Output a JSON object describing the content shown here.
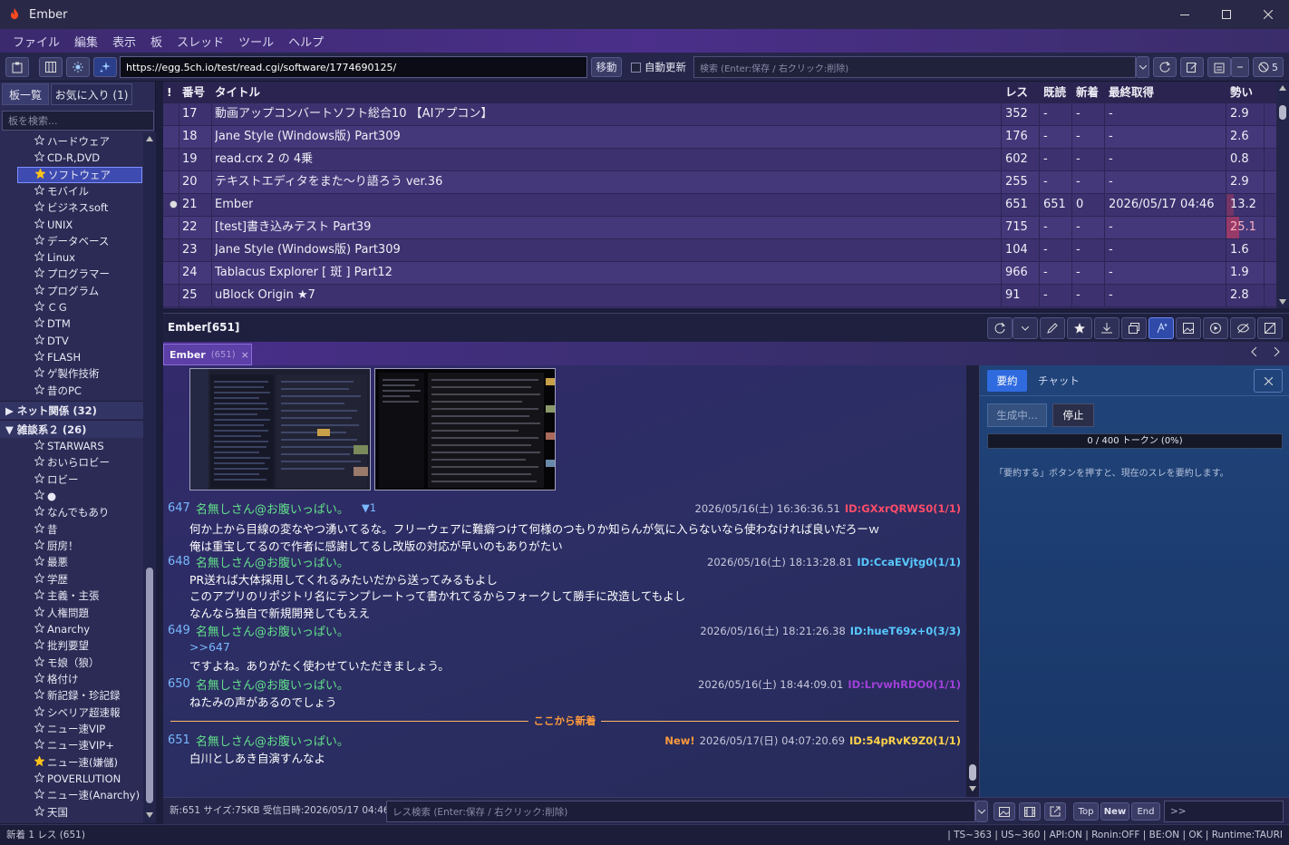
{
  "window": {
    "title": "Ember"
  },
  "menu": [
    "ファイル",
    "編集",
    "表示",
    "板",
    "スレッド",
    "ツール",
    "ヘルプ"
  ],
  "toolbar": {
    "url": "https://egg.5ch.io/test/read.cgi/software/1774690125/",
    "go_label": "移動",
    "auto_update_label": "自動更新",
    "search_placeholder": "検索 (Enter:保存 / 右クリック:削除)",
    "ng_count": "5"
  },
  "left_panel": {
    "tab_boards": "板一覧",
    "tab_favorites": "お気に入り (1)",
    "search_placeholder": "板を検索...",
    "boards_top": [
      "ハードウェア",
      "CD-R,DVD",
      "ソフトウェア",
      "モバイル",
      "ビジネスsoft",
      "UNIX",
      "データベース",
      "Linux",
      "プログラマー",
      "プログラム",
      "ＣＧ",
      "DTM",
      "DTV",
      "FLASH",
      "ゲ製作技術",
      "昔のPC"
    ],
    "category_net": "▶ ネット関係 (32)",
    "category_zatsudan": "▼ 雑談系２ (26)",
    "boards_bottom": [
      "STARWARS",
      "おいらロビー",
      "ロビー",
      "●",
      "なんでもあり",
      "昔",
      "厨房！",
      "最悪",
      "学歴",
      "主義・主張",
      "人権問題",
      "Anarchy",
      "批判要望",
      "モ娘（狼）",
      "格付け",
      "新記録・珍記録",
      "シベリア超速報",
      "ニュー速VIP",
      "ニュー速VIP+",
      "ニュー速(嫌儲)",
      "POVERLUTION",
      "ニュー速(Anarchy)",
      "天国"
    ]
  },
  "thread_list": {
    "headers": {
      "mark": "!",
      "num": "番号",
      "title": "タイトル",
      "res": "レス",
      "read": "既読",
      "new": "新着",
      "last": "最終取得",
      "momentum": "勢い"
    },
    "rows": [
      {
        "mark": "",
        "num": "17",
        "title": "動画アップコンバートソフト総合10 【AIアプコン】",
        "res": "352",
        "read": "-",
        "new": "-",
        "last": "-",
        "momentum": "2.9"
      },
      {
        "mark": "",
        "num": "18",
        "title": "Jane Style (Windows版) Part309",
        "res": "176",
        "read": "-",
        "new": "-",
        "last": "-",
        "momentum": "2.6"
      },
      {
        "mark": "",
        "num": "19",
        "title": "read.crx 2 の 4乗",
        "res": "602",
        "read": "-",
        "new": "-",
        "last": "-",
        "momentum": "0.8"
      },
      {
        "mark": "",
        "num": "20",
        "title": "テキストエディタをまた～り語ろう ver.36",
        "res": "255",
        "read": "-",
        "new": "-",
        "last": "-",
        "momentum": "2.9"
      },
      {
        "mark": "●",
        "num": "21",
        "title": "Ember",
        "res": "651",
        "read": "651",
        "new": "0",
        "last": "2026/05/17 04:46",
        "momentum": "13.2"
      },
      {
        "mark": "",
        "num": "22",
        "title": "[test]書き込みテスト Part39",
        "res": "715",
        "read": "-",
        "new": "-",
        "last": "-",
        "momentum": "25.1"
      },
      {
        "mark": "",
        "num": "23",
        "title": "Jane Style (Windows版) Part309",
        "res": "104",
        "read": "-",
        "new": "-",
        "last": "-",
        "momentum": "1.6"
      },
      {
        "mark": "",
        "num": "24",
        "title": "Tablacus Explorer [ 斑 ] Part12",
        "res": "966",
        "read": "-",
        "new": "-",
        "last": "-",
        "momentum": "1.9"
      },
      {
        "mark": "",
        "num": "25",
        "title": "uBlock Origin ★7",
        "res": "91",
        "read": "-",
        "new": "-",
        "last": "-",
        "momentum": "2.8"
      }
    ]
  },
  "thread_view": {
    "title": "Ember[651]",
    "tab_name": "Ember",
    "tab_count": "(651)",
    "new_divider": "ここから新着",
    "posts": [
      {
        "num": "647",
        "name": "名無しさん@お腹いっぱい。",
        "ref": "▼1",
        "date": "2026/05/16(土) 16:36:36.51",
        "id": "ID:GXxrQRWS0(1/1)",
        "id_color": "#ff4d6a",
        "lines": [
          "何か上から目線の変なやつ湧いてるな。フリーウェアに難癖つけて何様のつもりか知らんが気に入らないなら使わなければ良いだろーｗ",
          "俺は重宝してるので作者に感謝してるし改版の対応が早いのもありがたい"
        ]
      },
      {
        "num": "648",
        "name": "名無しさん@お腹いっぱい。",
        "date": "2026/05/16(土) 18:13:28.81",
        "id": "ID:CcaEVjtg0(1/1)",
        "id_color": "#58c8ff",
        "lines": [
          "PR送れば大体採用してくれるみたいだから送ってみるもよし",
          "このアプリのリポジトリ名にテンプレートって書かれてるからフォークして勝手に改造してもよし",
          "なんなら独自で新規開発してもええ"
        ]
      },
      {
        "num": "649",
        "name": "名無しさん@お腹いっぱい。",
        "date": "2026/05/16(土) 18:21:26.38",
        "id": "ID:hueT69x+0(3/3)",
        "id_color": "#58c8ff",
        "anchor": ">>647",
        "lines": [
          "ですよね。ありがたく使わせていただきましょう。"
        ]
      },
      {
        "num": "650",
        "name": "名無しさん@お腹いっぱい。",
        "date": "2026/05/16(土) 18:44:09.01",
        "id": "ID:LrvwhRDO0(1/1)",
        "id_color": "#a040d8",
        "lines": [
          "ねたみの声があるのでしょう"
        ]
      },
      {
        "num": "651",
        "name": "名無しさん@お腹いっぱい。",
        "new_badge": "New!",
        "date": "2026/05/17(日) 04:07:20.69",
        "id": "ID:54pRvK9Z0(1/1)",
        "id_color": "#ffd24a",
        "lines": [
          "白川としあき自演すんなよ"
        ]
      }
    ]
  },
  "ai_panel": {
    "tab_summary": "要約",
    "tab_chat": "チャット",
    "generating_label": "生成中...",
    "stop_label": "停止",
    "token_progress": "0 / 400 トークン (0%)",
    "hint": "「要約する」ボタンを押すと、現在のスレを要約します。"
  },
  "bottom_bar": {
    "stats": "新:651 サイズ:75KB 受信日時:2026/05/17 04:46",
    "search_placeholder": "レス検索 (Enter:保存 / 右クリック:削除)",
    "top_label": "Top",
    "new_label": "New",
    "end_label": "End",
    "anchor_input": ">>"
  },
  "statusbar": {
    "left": "新着 1 レス (651)",
    "right": "| TS~363 | US~360 | API:ON | Ronin:OFF | BE:ON | OK | Runtime:TAURI"
  }
}
